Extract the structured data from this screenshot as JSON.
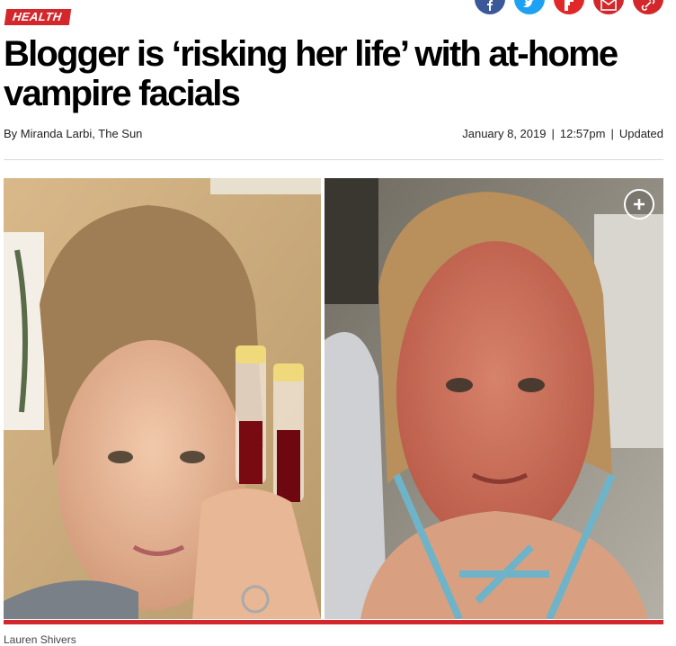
{
  "section": {
    "label": "HEALTH"
  },
  "share": {
    "buttons": [
      {
        "name": "facebook-share-button",
        "icon": "facebook-icon",
        "color": "#3b5998"
      },
      {
        "name": "twitter-share-button",
        "icon": "twitter-icon",
        "color": "#1da1f2"
      },
      {
        "name": "flipboard-share-button",
        "icon": "flipboard-icon",
        "color": "#e12828"
      },
      {
        "name": "email-share-button",
        "icon": "email-icon",
        "color": "#d3272b"
      },
      {
        "name": "copy-link-button",
        "icon": "link-icon",
        "color": "#d3272b"
      }
    ]
  },
  "article": {
    "headline": "Blogger is ‘risking her life’ with at-home vampire facials",
    "byline_prefix": "By",
    "author": "Miranda Larbi, The Sun",
    "date": "January 8, 2019",
    "time": "12:57pm",
    "sep": "|",
    "updated_label": "Updated"
  },
  "photo": {
    "expand_icon": "plus-circle-icon",
    "credit": "Lauren Shivers"
  },
  "colors": {
    "brand_red": "#d3272b",
    "text": "#000000"
  }
}
